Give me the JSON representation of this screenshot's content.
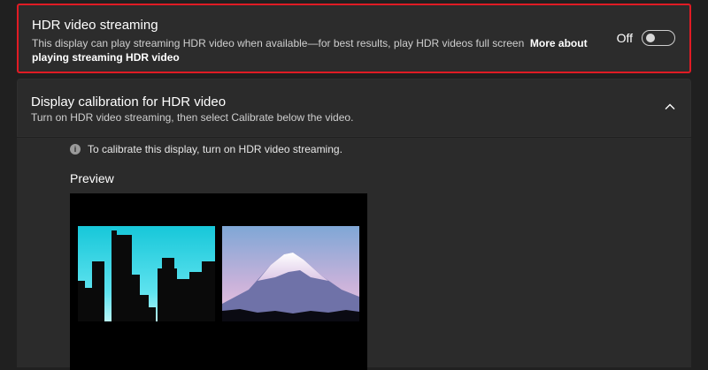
{
  "hdr_streaming": {
    "title": "HDR video streaming",
    "description": "This display can play streaming HDR video when available—for best results, play HDR videos full screen",
    "link_text": "More about playing streaming HDR video",
    "toggle_state": "Off",
    "toggle_on": false
  },
  "calibration": {
    "title": "Display calibration for HDR video",
    "description": "Turn on HDR video streaming, then select Calibrate below the video.",
    "expanded": true,
    "info_icon": "info-icon",
    "info_text": "To calibrate this display, turn on HDR video streaming.",
    "preview_label": "Preview",
    "preview_images": [
      "city-skyline",
      "snow-mountain"
    ]
  },
  "colors": {
    "highlight_border": "#e01b24",
    "background": "#202020",
    "card": "#2b2b2b"
  }
}
